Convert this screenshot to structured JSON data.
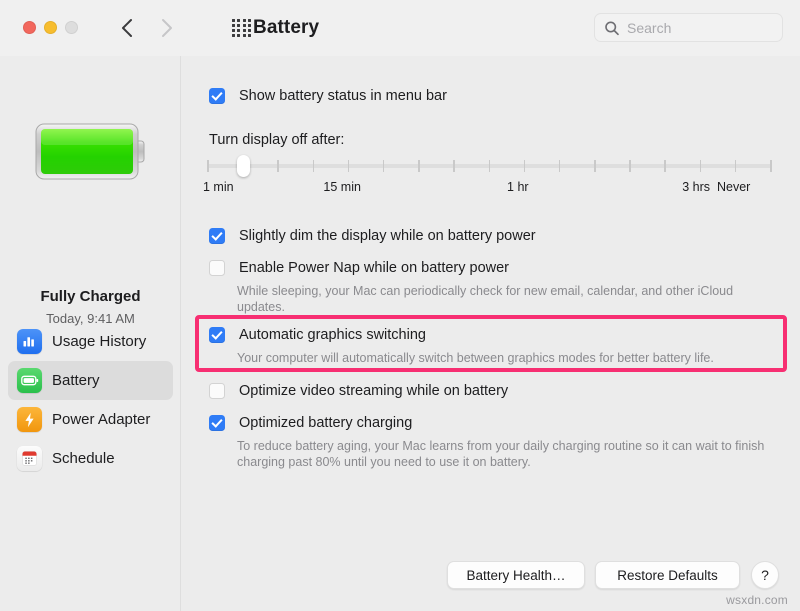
{
  "window": {
    "title": "Battery",
    "traffic_lights": [
      "close-red",
      "minimize-yellow",
      "zoom-gray-disabled"
    ],
    "back_label": "Back",
    "forward_label": "Forward",
    "grid_label": "Show All"
  },
  "search": {
    "placeholder": "Search",
    "value": "",
    "icon": "search-icon"
  },
  "sidebar": {
    "battery_status_title": "Fully Charged",
    "battery_status_sub": "Today, 9:41 AM",
    "battery_icon": "battery-full-green-icon",
    "items": [
      {
        "label": "Usage History",
        "icon": "bar-chart-icon",
        "icon_color": "#2f7cf6",
        "selected": false
      },
      {
        "label": "Battery",
        "icon": "battery-icon",
        "icon_color": "#34c759",
        "selected": true
      },
      {
        "label": "Power Adapter",
        "icon": "bolt-icon",
        "icon_color": "#f5a623",
        "selected": false
      },
      {
        "label": "Schedule",
        "icon": "calendar-icon",
        "icon_color": "#e03a2f",
        "selected": false
      }
    ]
  },
  "main": {
    "show_status_checkbox": {
      "label": "Show battery status in menu bar",
      "checked": true
    },
    "display_off_label": "Turn display off after:",
    "slider": {
      "tick_count": 17,
      "value_index": 1,
      "labels": [
        "1 min",
        "15 min",
        "1 hr",
        "3 hrs",
        "Never"
      ],
      "label_positions": [
        0,
        24.5,
        57,
        88,
        100
      ]
    },
    "options": [
      {
        "label": "Slightly dim the display while on battery power",
        "checked": true,
        "description": "",
        "highlighted": false
      },
      {
        "label": "Enable Power Nap while on battery power",
        "checked": false,
        "description": "While sleeping, your Mac can periodically check for new email, calendar, and other iCloud updates.",
        "highlighted": false
      },
      {
        "label": "Automatic graphics switching",
        "checked": true,
        "description": "Your computer will automatically switch between graphics modes for better battery life.",
        "highlighted": true
      },
      {
        "label": "Optimize video streaming while on battery",
        "checked": false,
        "description": "",
        "highlighted": false
      },
      {
        "label": "Optimized battery charging",
        "checked": true,
        "description": "To reduce battery aging, your Mac learns from your daily charging routine so it can wait to finish charging past 80% until you need to use it on battery.",
        "highlighted": false
      }
    ],
    "highlight_color": "#f72f72"
  },
  "footer": {
    "battery_health_label": "Battery Health…",
    "restore_defaults_label": "Restore Defaults",
    "help_label": "?"
  },
  "watermark": "wsxdn.com"
}
